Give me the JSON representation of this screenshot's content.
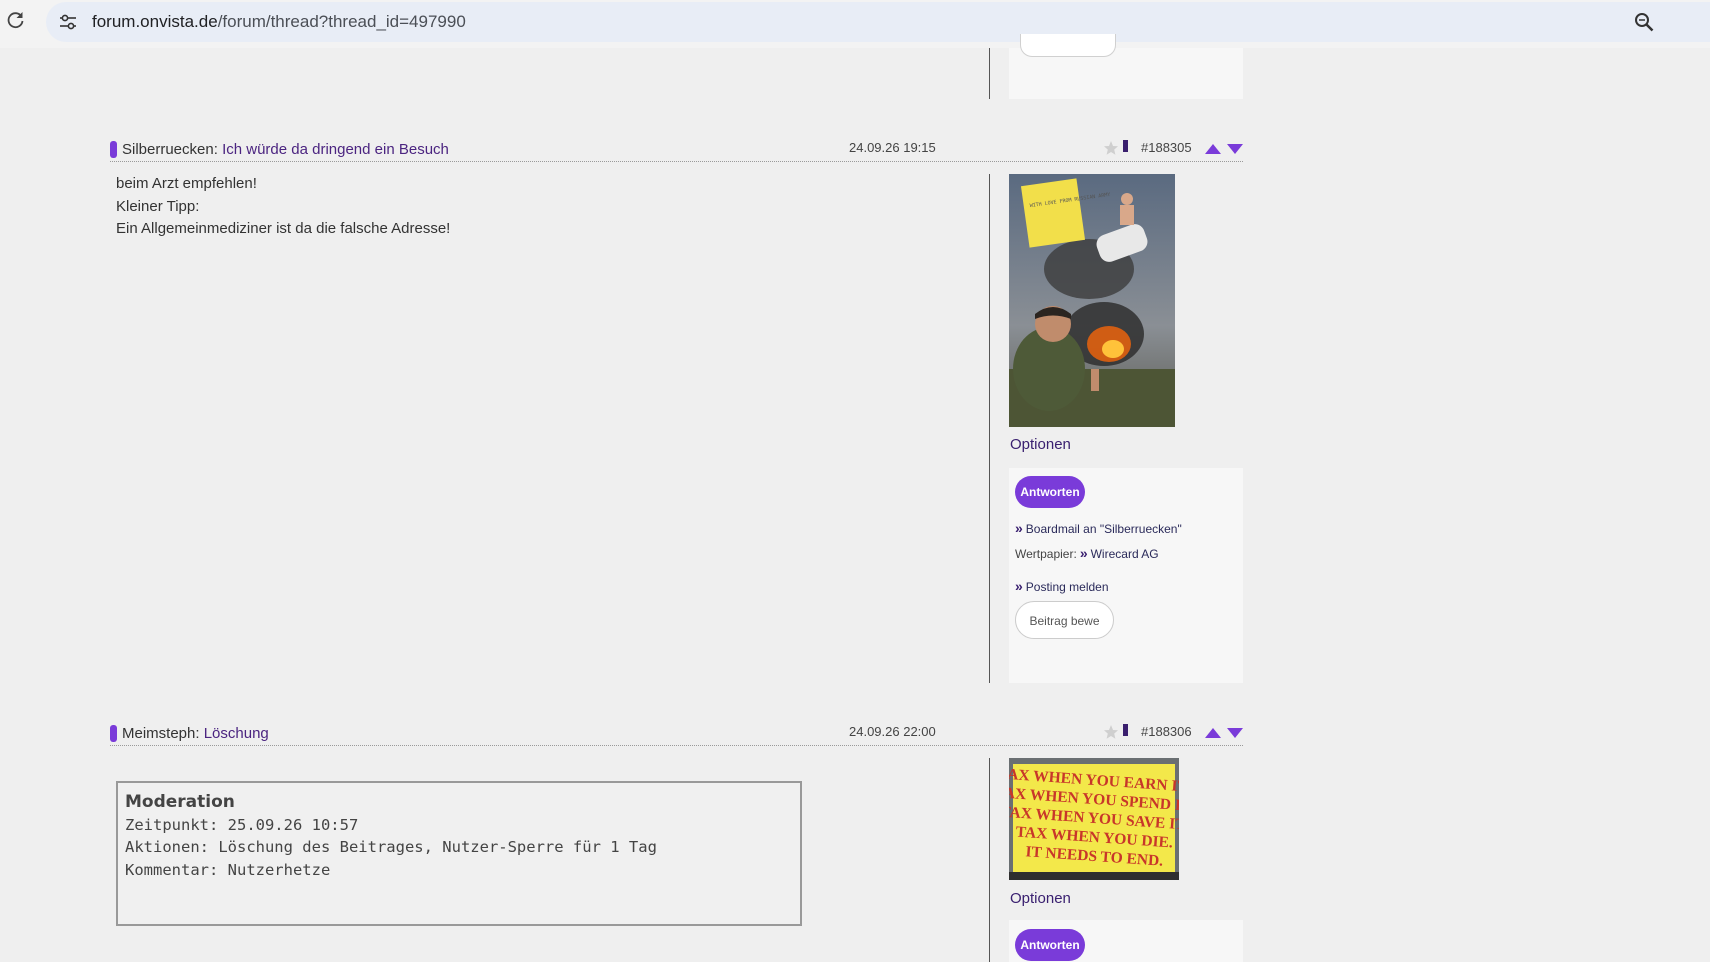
{
  "browser": {
    "url_host": "forum.onvista.de",
    "url_path": "/forum/thread?thread_id=497990"
  },
  "posts": [
    {
      "author": "Silberruecken",
      "separator": ": ",
      "title": "Ich würde da dringend ein Besuch",
      "date": "24.09.26 19:15",
      "number": "#188305",
      "body_lines": [
        "beim Arzt empfehlen!",
        "Kleiner Tipp:",
        "Ein Allgemeinmediziner ist da die falsche Adresse!"
      ],
      "avatar_note_text": "WITH LOVE FROM RUSSIAN ARMY",
      "options_label": "Optionen",
      "reply_label": "Antworten",
      "boardmail_label": "Boardmail an \"Silberruecken\"",
      "wertpapier_label": "Wertpapier:",
      "wertpapier_value": "Wirecard AG",
      "report_label": "Posting melden",
      "rate_label": "Beitrag bewe"
    },
    {
      "author": "Meimsteph",
      "separator": ": ",
      "title": "Löschung",
      "date": "24.09.26 22:00",
      "number": "#188306",
      "moderation": {
        "title": "Moderation",
        "time": "Zeitpunkt: 25.09.26 10:57",
        "actions": "Aktionen: Löschung des Beitrages, Nutzer-Sperre für 1 Tag",
        "comment": "Kommentar: Nutzerhetze"
      },
      "avatar_lines": [
        "TAX WHEN YOU EARN IT.",
        "TAX WHEN YOU SPEND IT.",
        "TAX WHEN YOU SAVE IT.",
        "TAX WHEN YOU DIE.",
        "IT NEEDS TO END."
      ],
      "options_label": "Optionen",
      "reply_label": "Antworten"
    }
  ],
  "icons": [
    "reload-icon",
    "site-info-icon",
    "zoom-icon",
    "bookmark-star-icon",
    "rating-star-icon",
    "vote-up-icon",
    "vote-down-icon"
  ],
  "colors": {
    "accent": "#7a3bd9",
    "link": "#4b2480",
    "background": "#efefef"
  }
}
